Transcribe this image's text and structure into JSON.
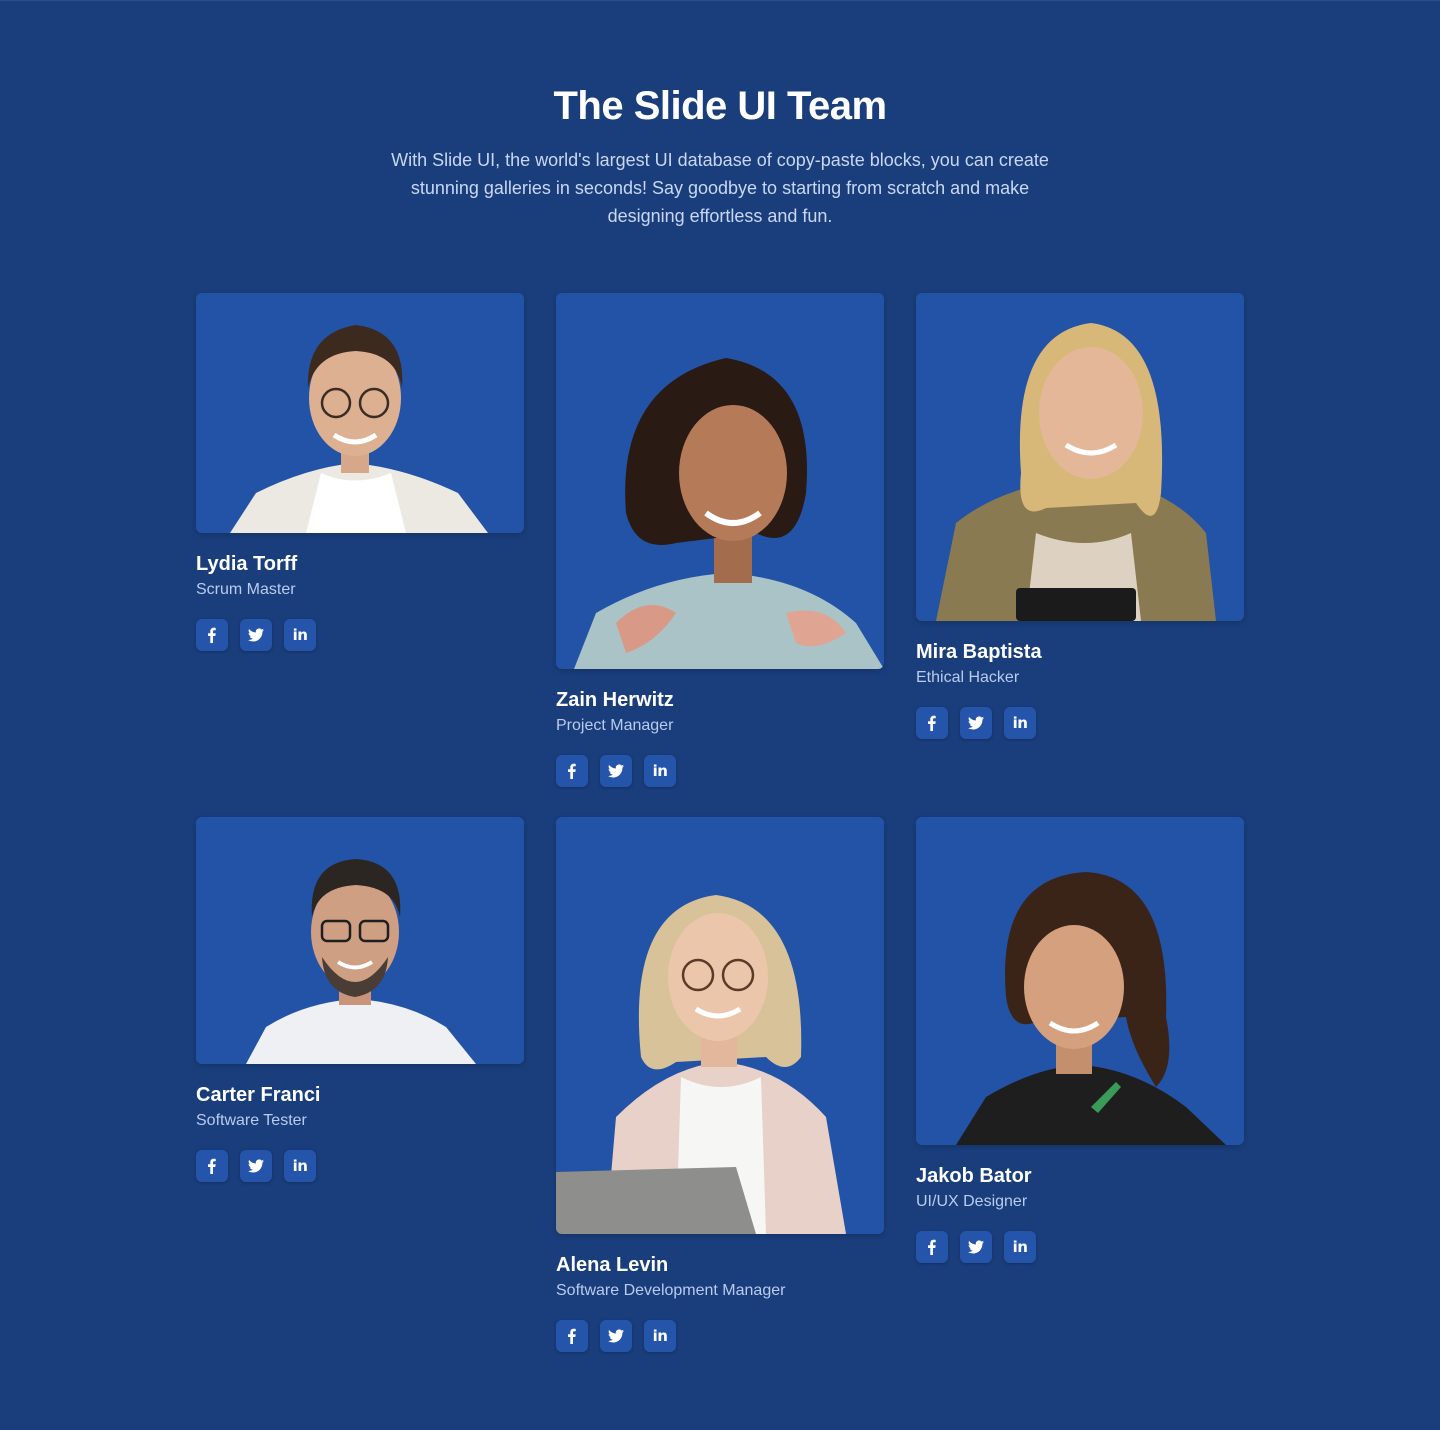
{
  "header": {
    "title": "The Slide UI Team",
    "subtitle": "With Slide UI, the world's largest UI database of copy-paste blocks, you can create stunning galleries in seconds! Say goodbye to starting from scratch and make designing effortless and fun."
  },
  "team": [
    {
      "name": "Lydia Torff",
      "role": "Scrum Master"
    },
    {
      "name": "Zain Herwitz",
      "role": "Project Manager"
    },
    {
      "name": "Mira Baptista",
      "role": "Ethical Hacker"
    },
    {
      "name": "Carter Franci",
      "role": "Software Tester"
    },
    {
      "name": "Alena Levin",
      "role": "Software Development Manager"
    },
    {
      "name": "Jakob Bator",
      "role": "UI/UX Designer"
    }
  ],
  "social": {
    "facebook_icon": "facebook-icon",
    "twitter_icon": "twitter-icon",
    "linkedin_label": "in"
  },
  "colors": {
    "background": "#1a3e7c",
    "card_background": "#2353a6",
    "title": "#ffffff",
    "subtitle": "#c9d7f2"
  }
}
